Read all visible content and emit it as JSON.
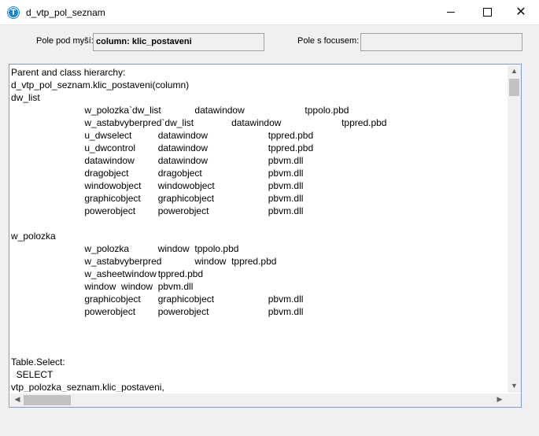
{
  "window": {
    "title": "d_vtp_pol_seznam",
    "min_glyph": "—",
    "close_glyph": "✕"
  },
  "fields": {
    "mouse_label": "Pole pod myší:",
    "mouse_value": "column: klic_postaveni",
    "focus_label": "Pole s focusem:",
    "focus_value": ""
  },
  "content": {
    "text": "Parent and class hierarchy:\nd_vtp_pol_seznam.klic_postaveni(column)\ndw_list\n\t\tw_polozka`dw_list\tdatawindow\t\ttppolo.pbd\n\t\tw_astabvyberpred`dw_list\tdatawindow\t\ttppred.pbd\n\t\tu_dwselect\tdatawindow\t\ttppred.pbd\n\t\tu_dwcontrol\tdatawindow\t\ttppred.pbd\n\t\tdatawindow\tdatawindow\t\tpbvm.dll\n\t\tdragobject\tdragobject\t\tpbvm.dll\n\t\twindowobject\twindowobject\t\tpbvm.dll\n\t\tgraphicobject\tgraphicobject\t\tpbvm.dll\n\t\tpowerobject\tpowerobject\t\tpbvm.dll\n\nw_polozka\n\t\tw_polozka\twindow\ttppolo.pbd\n\t\tw_astabvyberpred\twindow\ttppred.pbd\n\t\tw_asheetwindow\ttppred.pbd\n\t\twindow\twindow\tpbvm.dll\n\t\tgraphicobject\tgraphicobject\t\tpbvm.dll\n\t\tpowerobject\tpowerobject\t\tpbvm.dll\n\n\n\nTable.Select:\n  SELECT\nvtp_polozka_seznam.klic_postaveni,"
  },
  "scrollbars": {
    "up": "▲",
    "down": "▼",
    "left": "◀",
    "right": "▶"
  },
  "colors": {
    "app_icon": "#1a86d0",
    "panel_border": "#7a9cc6"
  }
}
